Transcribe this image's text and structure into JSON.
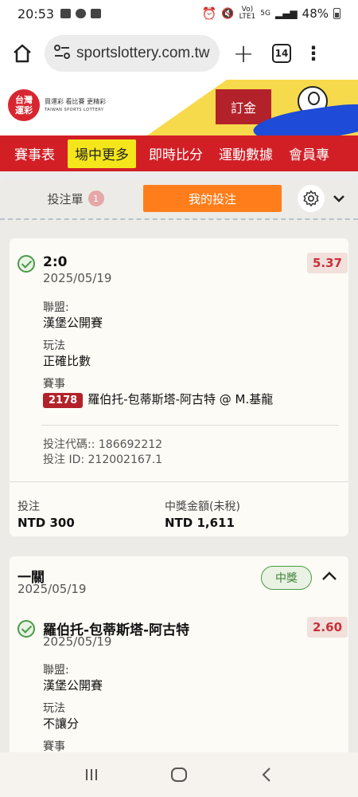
{
  "status_bar": {
    "time": "20:53",
    "network_vol": "Vo)",
    "network_lte": "LTE1",
    "network_5g": "5G",
    "battery": "48%"
  },
  "browser": {
    "url": "sportslottery.com.tw",
    "tab_count": "14"
  },
  "site_header": {
    "logo_line1": "台灣",
    "logo_line2": "運彩",
    "logo_tagline": "買運彩 看比賽 更精彩",
    "logo_en": "TAIWAN SPORTS LOTTERY",
    "order_button": "訂金"
  },
  "nav": {
    "items": [
      "賽事表",
      "場中更多",
      "即時比分",
      "運動數據",
      "會員專"
    ]
  },
  "slip": {
    "tab_slip_label": "投注單",
    "tab_slip_count": "1",
    "tab_mybets_label": "我的投注"
  },
  "bet1": {
    "selection": "2:0",
    "date": "2025/05/19",
    "odds": "5.37",
    "league_label": "聯盟:",
    "league": "漢堡公開賽",
    "market_label": "玩法",
    "market": "正確比數",
    "event_label": "賽事",
    "event_code": "2178",
    "event_name": "羅伯托-包蒂斯塔-阿古特 @ M.基龍",
    "bet_code": "投注代碼:: 186692212",
    "bet_id": "投注 ID: 212002167.1",
    "stake_label": "投注",
    "stake": "NTD 300",
    "payout_label": "中獎金額(未稅)",
    "payout": "NTD 1,611"
  },
  "bet2": {
    "type": "一關",
    "date": "2025/05/19",
    "status": "中獎",
    "selection": "羅伯托-包蒂斯塔-阿古特",
    "selection_date": "2025/05/19",
    "odds": "2.60",
    "league_label": "聯盟:",
    "league": "漢堡公開賽",
    "market_label": "玩法",
    "market": "不讓分",
    "event_label": "賽事"
  }
}
